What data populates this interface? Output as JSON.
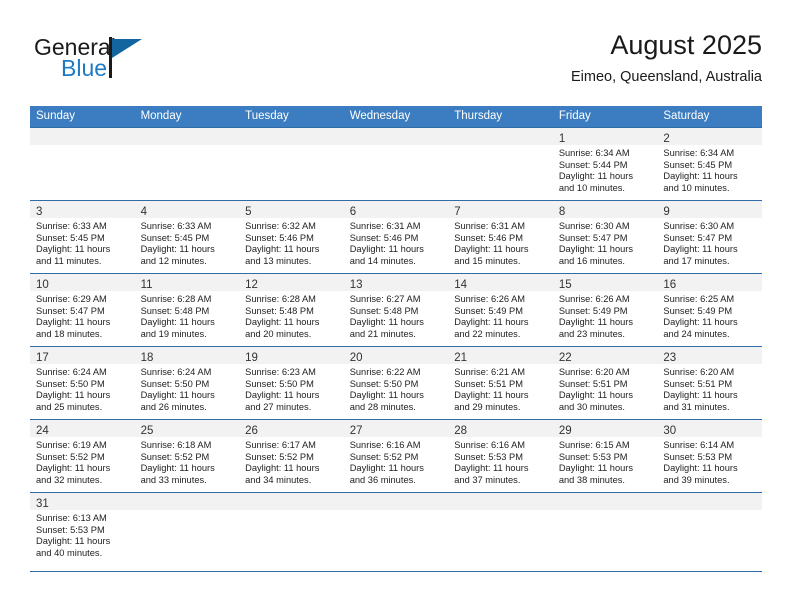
{
  "brand": {
    "name_part1": "General",
    "name_part2": "Blue",
    "flag_color": "#12659f",
    "blue_text_color": "#1f7ac4"
  },
  "header": {
    "title": "August 2025",
    "location": "Eimeo, Queensland, Australia"
  },
  "theme": {
    "header_row_bg": "#3b7dc0",
    "grid_line": "#2f6ca8",
    "daynum_band_bg": "#f2f2f2"
  },
  "weekdays": [
    "Sunday",
    "Monday",
    "Tuesday",
    "Wednesday",
    "Thursday",
    "Friday",
    "Saturday"
  ],
  "weeks": [
    [
      {
        "day": "",
        "lines": []
      },
      {
        "day": "",
        "lines": []
      },
      {
        "day": "",
        "lines": []
      },
      {
        "day": "",
        "lines": []
      },
      {
        "day": "",
        "lines": []
      },
      {
        "day": "1",
        "lines": [
          "Sunrise: 6:34 AM",
          "Sunset: 5:44 PM",
          "Daylight: 11 hours",
          "and 10 minutes."
        ]
      },
      {
        "day": "2",
        "lines": [
          "Sunrise: 6:34 AM",
          "Sunset: 5:45 PM",
          "Daylight: 11 hours",
          "and 10 minutes."
        ]
      }
    ],
    [
      {
        "day": "3",
        "lines": [
          "Sunrise: 6:33 AM",
          "Sunset: 5:45 PM",
          "Daylight: 11 hours",
          "and 11 minutes."
        ]
      },
      {
        "day": "4",
        "lines": [
          "Sunrise: 6:33 AM",
          "Sunset: 5:45 PM",
          "Daylight: 11 hours",
          "and 12 minutes."
        ]
      },
      {
        "day": "5",
        "lines": [
          "Sunrise: 6:32 AM",
          "Sunset: 5:46 PM",
          "Daylight: 11 hours",
          "and 13 minutes."
        ]
      },
      {
        "day": "6",
        "lines": [
          "Sunrise: 6:31 AM",
          "Sunset: 5:46 PM",
          "Daylight: 11 hours",
          "and 14 minutes."
        ]
      },
      {
        "day": "7",
        "lines": [
          "Sunrise: 6:31 AM",
          "Sunset: 5:46 PM",
          "Daylight: 11 hours",
          "and 15 minutes."
        ]
      },
      {
        "day": "8",
        "lines": [
          "Sunrise: 6:30 AM",
          "Sunset: 5:47 PM",
          "Daylight: 11 hours",
          "and 16 minutes."
        ]
      },
      {
        "day": "9",
        "lines": [
          "Sunrise: 6:30 AM",
          "Sunset: 5:47 PM",
          "Daylight: 11 hours",
          "and 17 minutes."
        ]
      }
    ],
    [
      {
        "day": "10",
        "lines": [
          "Sunrise: 6:29 AM",
          "Sunset: 5:47 PM",
          "Daylight: 11 hours",
          "and 18 minutes."
        ]
      },
      {
        "day": "11",
        "lines": [
          "Sunrise: 6:28 AM",
          "Sunset: 5:48 PM",
          "Daylight: 11 hours",
          "and 19 minutes."
        ]
      },
      {
        "day": "12",
        "lines": [
          "Sunrise: 6:28 AM",
          "Sunset: 5:48 PM",
          "Daylight: 11 hours",
          "and 20 minutes."
        ]
      },
      {
        "day": "13",
        "lines": [
          "Sunrise: 6:27 AM",
          "Sunset: 5:48 PM",
          "Daylight: 11 hours",
          "and 21 minutes."
        ]
      },
      {
        "day": "14",
        "lines": [
          "Sunrise: 6:26 AM",
          "Sunset: 5:49 PM",
          "Daylight: 11 hours",
          "and 22 minutes."
        ]
      },
      {
        "day": "15",
        "lines": [
          "Sunrise: 6:26 AM",
          "Sunset: 5:49 PM",
          "Daylight: 11 hours",
          "and 23 minutes."
        ]
      },
      {
        "day": "16",
        "lines": [
          "Sunrise: 6:25 AM",
          "Sunset: 5:49 PM",
          "Daylight: 11 hours",
          "and 24 minutes."
        ]
      }
    ],
    [
      {
        "day": "17",
        "lines": [
          "Sunrise: 6:24 AM",
          "Sunset: 5:50 PM",
          "Daylight: 11 hours",
          "and 25 minutes."
        ]
      },
      {
        "day": "18",
        "lines": [
          "Sunrise: 6:24 AM",
          "Sunset: 5:50 PM",
          "Daylight: 11 hours",
          "and 26 minutes."
        ]
      },
      {
        "day": "19",
        "lines": [
          "Sunrise: 6:23 AM",
          "Sunset: 5:50 PM",
          "Daylight: 11 hours",
          "and 27 minutes."
        ]
      },
      {
        "day": "20",
        "lines": [
          "Sunrise: 6:22 AM",
          "Sunset: 5:50 PM",
          "Daylight: 11 hours",
          "and 28 minutes."
        ]
      },
      {
        "day": "21",
        "lines": [
          "Sunrise: 6:21 AM",
          "Sunset: 5:51 PM",
          "Daylight: 11 hours",
          "and 29 minutes."
        ]
      },
      {
        "day": "22",
        "lines": [
          "Sunrise: 6:20 AM",
          "Sunset: 5:51 PM",
          "Daylight: 11 hours",
          "and 30 minutes."
        ]
      },
      {
        "day": "23",
        "lines": [
          "Sunrise: 6:20 AM",
          "Sunset: 5:51 PM",
          "Daylight: 11 hours",
          "and 31 minutes."
        ]
      }
    ],
    [
      {
        "day": "24",
        "lines": [
          "Sunrise: 6:19 AM",
          "Sunset: 5:52 PM",
          "Daylight: 11 hours",
          "and 32 minutes."
        ]
      },
      {
        "day": "25",
        "lines": [
          "Sunrise: 6:18 AM",
          "Sunset: 5:52 PM",
          "Daylight: 11 hours",
          "and 33 minutes."
        ]
      },
      {
        "day": "26",
        "lines": [
          "Sunrise: 6:17 AM",
          "Sunset: 5:52 PM",
          "Daylight: 11 hours",
          "and 34 minutes."
        ]
      },
      {
        "day": "27",
        "lines": [
          "Sunrise: 6:16 AM",
          "Sunset: 5:52 PM",
          "Daylight: 11 hours",
          "and 36 minutes."
        ]
      },
      {
        "day": "28",
        "lines": [
          "Sunrise: 6:16 AM",
          "Sunset: 5:53 PM",
          "Daylight: 11 hours",
          "and 37 minutes."
        ]
      },
      {
        "day": "29",
        "lines": [
          "Sunrise: 6:15 AM",
          "Sunset: 5:53 PM",
          "Daylight: 11 hours",
          "and 38 minutes."
        ]
      },
      {
        "day": "30",
        "lines": [
          "Sunrise: 6:14 AM",
          "Sunset: 5:53 PM",
          "Daylight: 11 hours",
          "and 39 minutes."
        ]
      }
    ],
    [
      {
        "day": "31",
        "lines": [
          "Sunrise: 6:13 AM",
          "Sunset: 5:53 PM",
          "Daylight: 11 hours",
          "and 40 minutes."
        ]
      },
      {
        "day": "",
        "lines": []
      },
      {
        "day": "",
        "lines": []
      },
      {
        "day": "",
        "lines": []
      },
      {
        "day": "",
        "lines": []
      },
      {
        "day": "",
        "lines": []
      },
      {
        "day": "",
        "lines": []
      }
    ]
  ]
}
